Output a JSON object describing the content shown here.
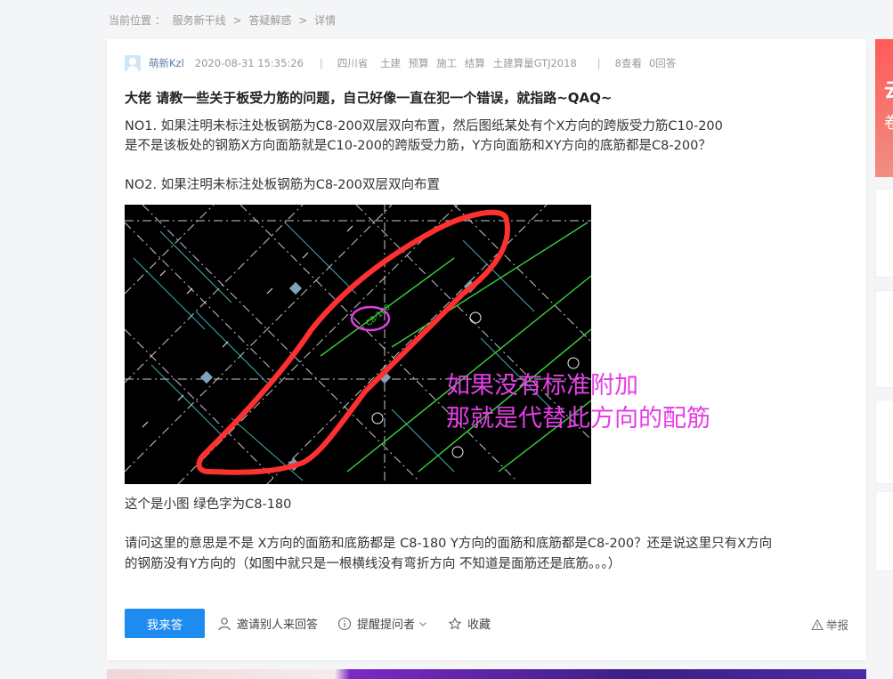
{
  "breadcrumb": {
    "label": "当前位置 ：",
    "items": [
      "服务新干线",
      "答疑解惑",
      "详情"
    ],
    "separator": ">"
  },
  "question": {
    "author": "萌新Kzl",
    "date": "2020-08-31 15:35:26",
    "tags": [
      "四川省",
      "土建",
      "预算",
      "施工",
      "结算",
      "土建算量GTJ2018"
    ],
    "views": "8查看",
    "answers": "0回答",
    "title": "大佬 请教一些关于板受力筋的问题，自己好像一直在犯一个错误，就指路~QAQ~",
    "paragraphs": [
      "NO1.      如果注明未标注处板钢筋为C8-200双层双向布置，然后图纸某处有个X方向的跨版受力筋C10-200",
      " 是不是该板处的钢筋X方向面筋就是C10-200的跨版受力筋，Y方向面筋和XY方向的底筋都是C8-200？",
      "NO2.      如果注明未标注处板钢筋为C8-200双层双向布置",
      "这个是小图 绿色字为C8-180",
      "请问这里的意思是不是 X方向的面筋和底筋都是 C8-180    Y方向的面筋和底筋都是C8-200？还是说这里只有X方向",
      "的钢筋没有Y方向的（如图中就只是一根横线没有弯折方向 不知道是面筋还是底筋。。。）"
    ],
    "image_overlay": [
      "如果没有标准附加",
      "那就是代替此方向的配筋"
    ]
  },
  "actions": {
    "answer": "我来答",
    "invite": "邀请别人来回答",
    "remind": "提醒提问者",
    "favorite": "收藏",
    "report": "举报"
  },
  "right_rail": {
    "promo_chars": [
      "云",
      "卷"
    ]
  },
  "colors": {
    "primary": "#1e8bf0",
    "overlay_text": "#e43ee6",
    "annotation_red": "#ff3030",
    "cad_green": "#3ad43a"
  }
}
